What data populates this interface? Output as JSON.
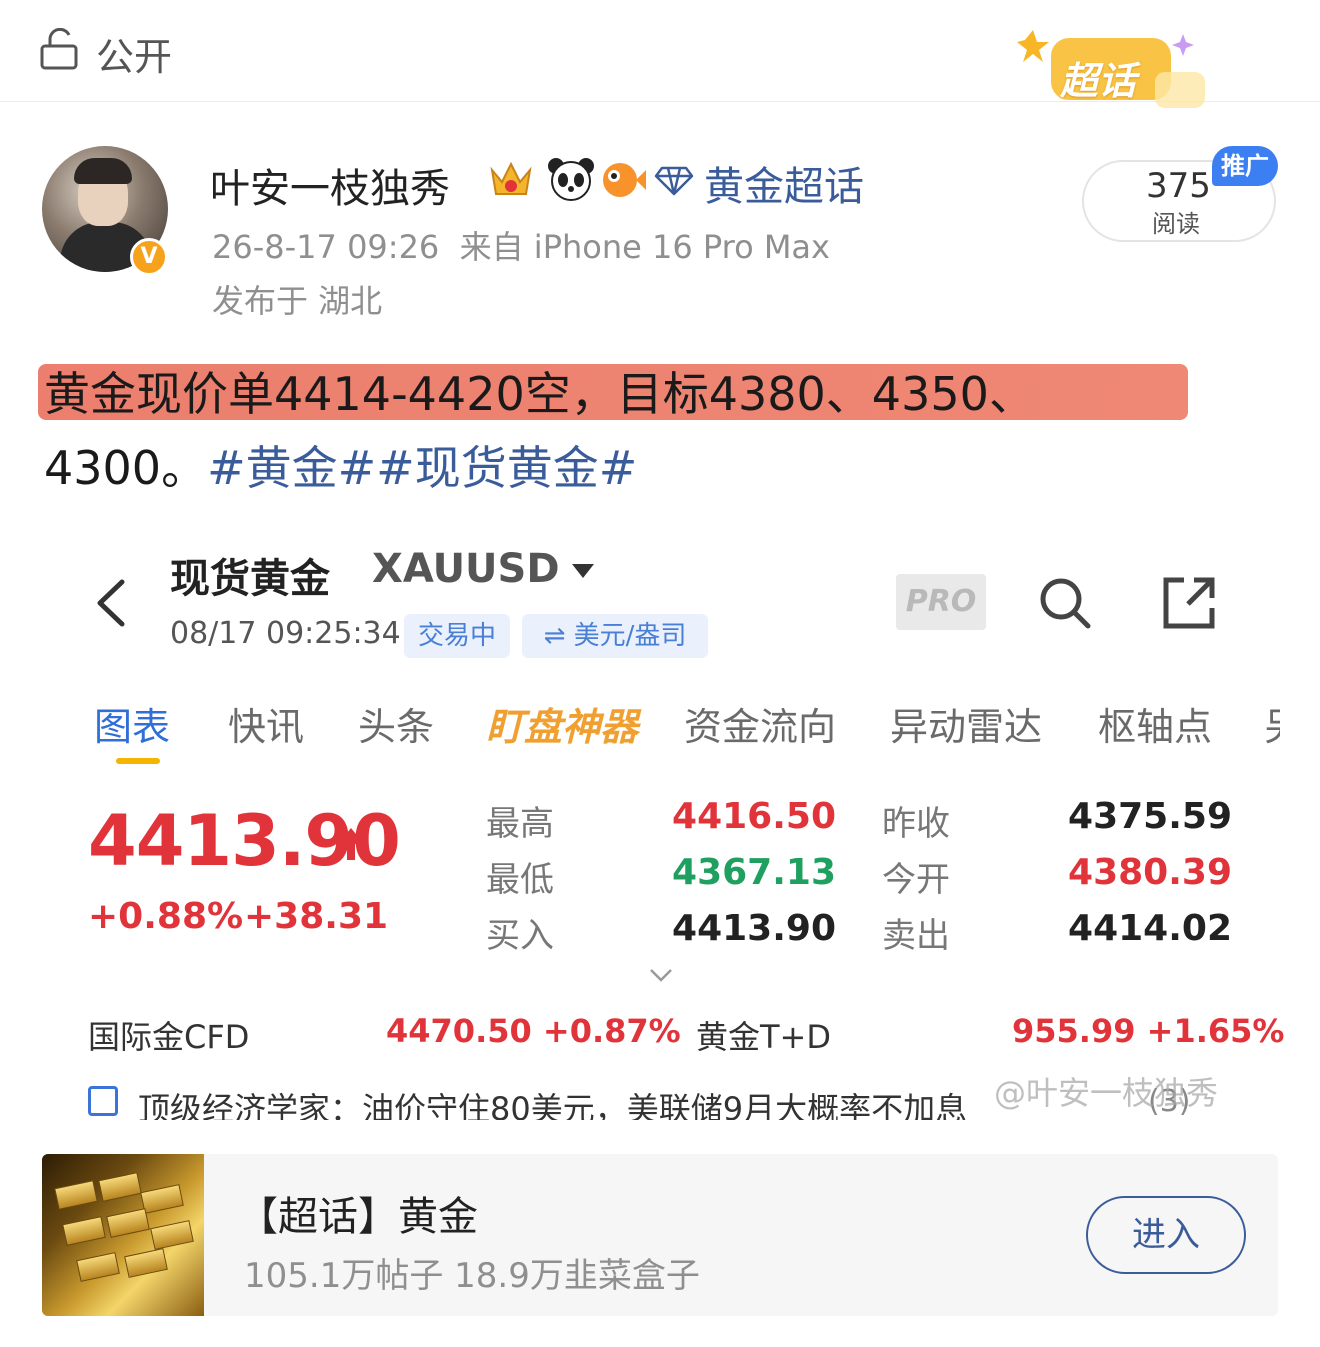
{
  "header": {
    "privacy_label": "公开",
    "badge_text": "超话"
  },
  "author": {
    "name": "叶安一枝独秀",
    "verified_mark": "V",
    "topic_link": "黄金超话",
    "timestamp": "26-8-17 09:26",
    "source": "来自 iPhone 16 Pro Max",
    "location": "发布于 湖北",
    "reads": "375",
    "reads_label": "阅读",
    "promo_tag": "推广"
  },
  "post": {
    "line1": "黄金现价单4414-4420空，目标4380、4350、",
    "line2_text": "4300。",
    "line2_tags": "#黄金##现货黄金#"
  },
  "quote": {
    "name": "现货黄金",
    "symbol": "XAUUSD",
    "time": "08/17 09:25:34",
    "status_pill": "交易中",
    "unit_pill": "⇌ 美元/盎司",
    "pro": "PRO",
    "tabs": [
      "图表",
      "快讯",
      "头条",
      "盯盘神器",
      "资金流向",
      "异动雷达",
      "枢轴点",
      "另"
    ],
    "price": "4413.90",
    "change_pct": "+0.88%",
    "change_abs": "+38.31",
    "stats": {
      "high_label": "最高",
      "high": "4416.50",
      "low_label": "最低",
      "low": "4367.13",
      "bid_label": "买入",
      "bid": "4413.90",
      "prev_close_label": "昨收",
      "prev_close": "4375.59",
      "open_label": "今开",
      "open": "4380.39",
      "ask_label": "卖出",
      "ask": "4414.02"
    },
    "related": {
      "cfd_label": "国际金CFD",
      "cfd_value": "4470.50  +0.87%",
      "td_label": "黄金T+D",
      "td_value": "955.99  +1.65%"
    },
    "news": "顶级经济学家：油价守住80美元，美联储9月大概率不加息",
    "news_count": "(3)"
  },
  "watermark": "@叶安一枝独秀",
  "card": {
    "title": "【超话】黄金",
    "subtitle": "105.1万帖子 18.9万韭菜盒子",
    "enter": "进入"
  },
  "colors": {
    "up_red": "#e0333a",
    "down_green": "#20a060",
    "link_blue": "#3b5c9a",
    "tab_active": "#2f6fd6",
    "highlight": "#e86854"
  }
}
